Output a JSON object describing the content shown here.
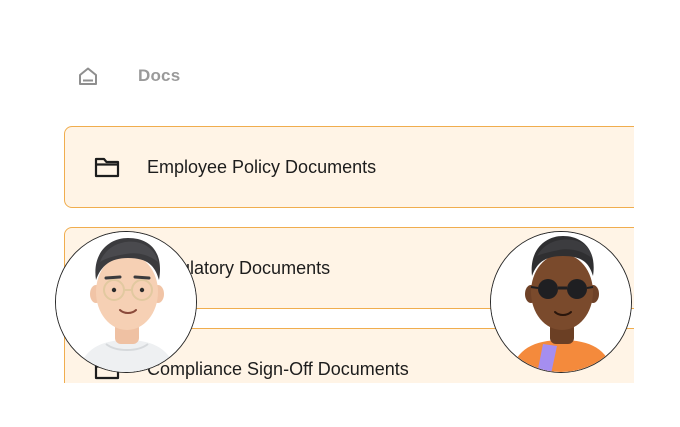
{
  "breadcrumb": {
    "home_icon": "home-icon",
    "label": "Docs"
  },
  "folders": [
    {
      "label": "Employee Policy Documents",
      "icon": "folder-icon"
    },
    {
      "label": "Regulatory Documents",
      "icon": "folder-icon"
    },
    {
      "label": "Compliance Sign-Off Documents",
      "icon": "folder-icon"
    }
  ],
  "avatars": [
    {
      "name": "user-avatar-glasses"
    },
    {
      "name": "user-avatar-sunglasses"
    }
  ],
  "colors": {
    "row_background": "#fff4e6",
    "row_border": "#f0ad4e",
    "breadcrumb_text": "#9a9a9a"
  }
}
